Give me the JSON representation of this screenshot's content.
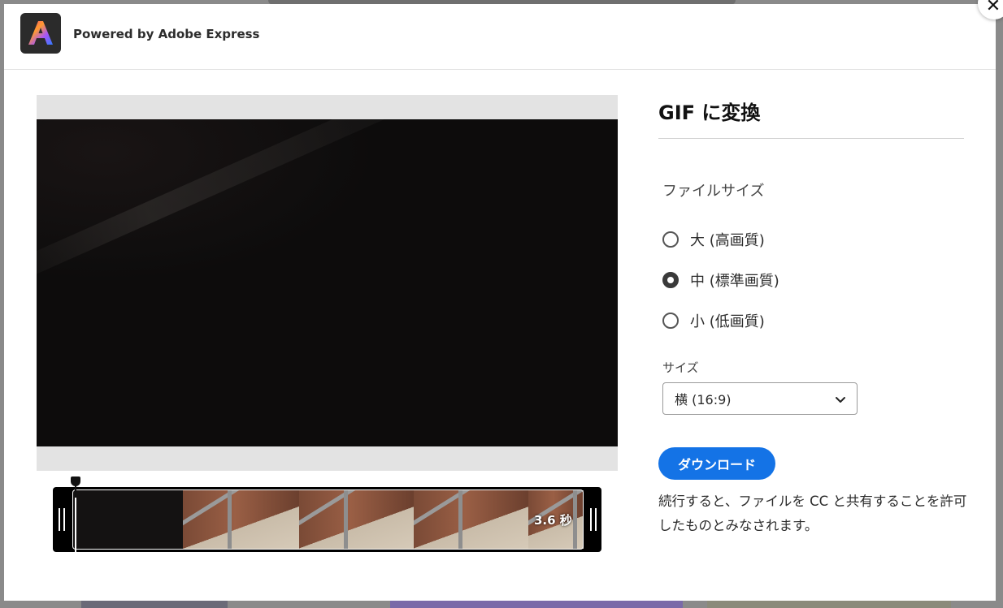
{
  "header": {
    "powered_by": "Powered by Adobe Express"
  },
  "close_glyph": "✕",
  "panel": {
    "title": "GIF に変換",
    "file_size_label": "ファイルサイズ",
    "options": [
      {
        "label": "大 (高画質)",
        "selected": false
      },
      {
        "label": "中 (標準画質)",
        "selected": true
      },
      {
        "label": "小 (低画質)",
        "selected": false
      }
    ],
    "size_label": "サイズ",
    "size_select": {
      "value": "横 (16:9)"
    },
    "download_label": "ダウンロード",
    "notice": "続行すると、ファイルを CC と共有することを許可したものとみなされます。"
  },
  "timeline": {
    "duration": "3.6 秒"
  },
  "colors": {
    "accent": "#1473e6",
    "logo_bg": "#2b2b2b"
  }
}
